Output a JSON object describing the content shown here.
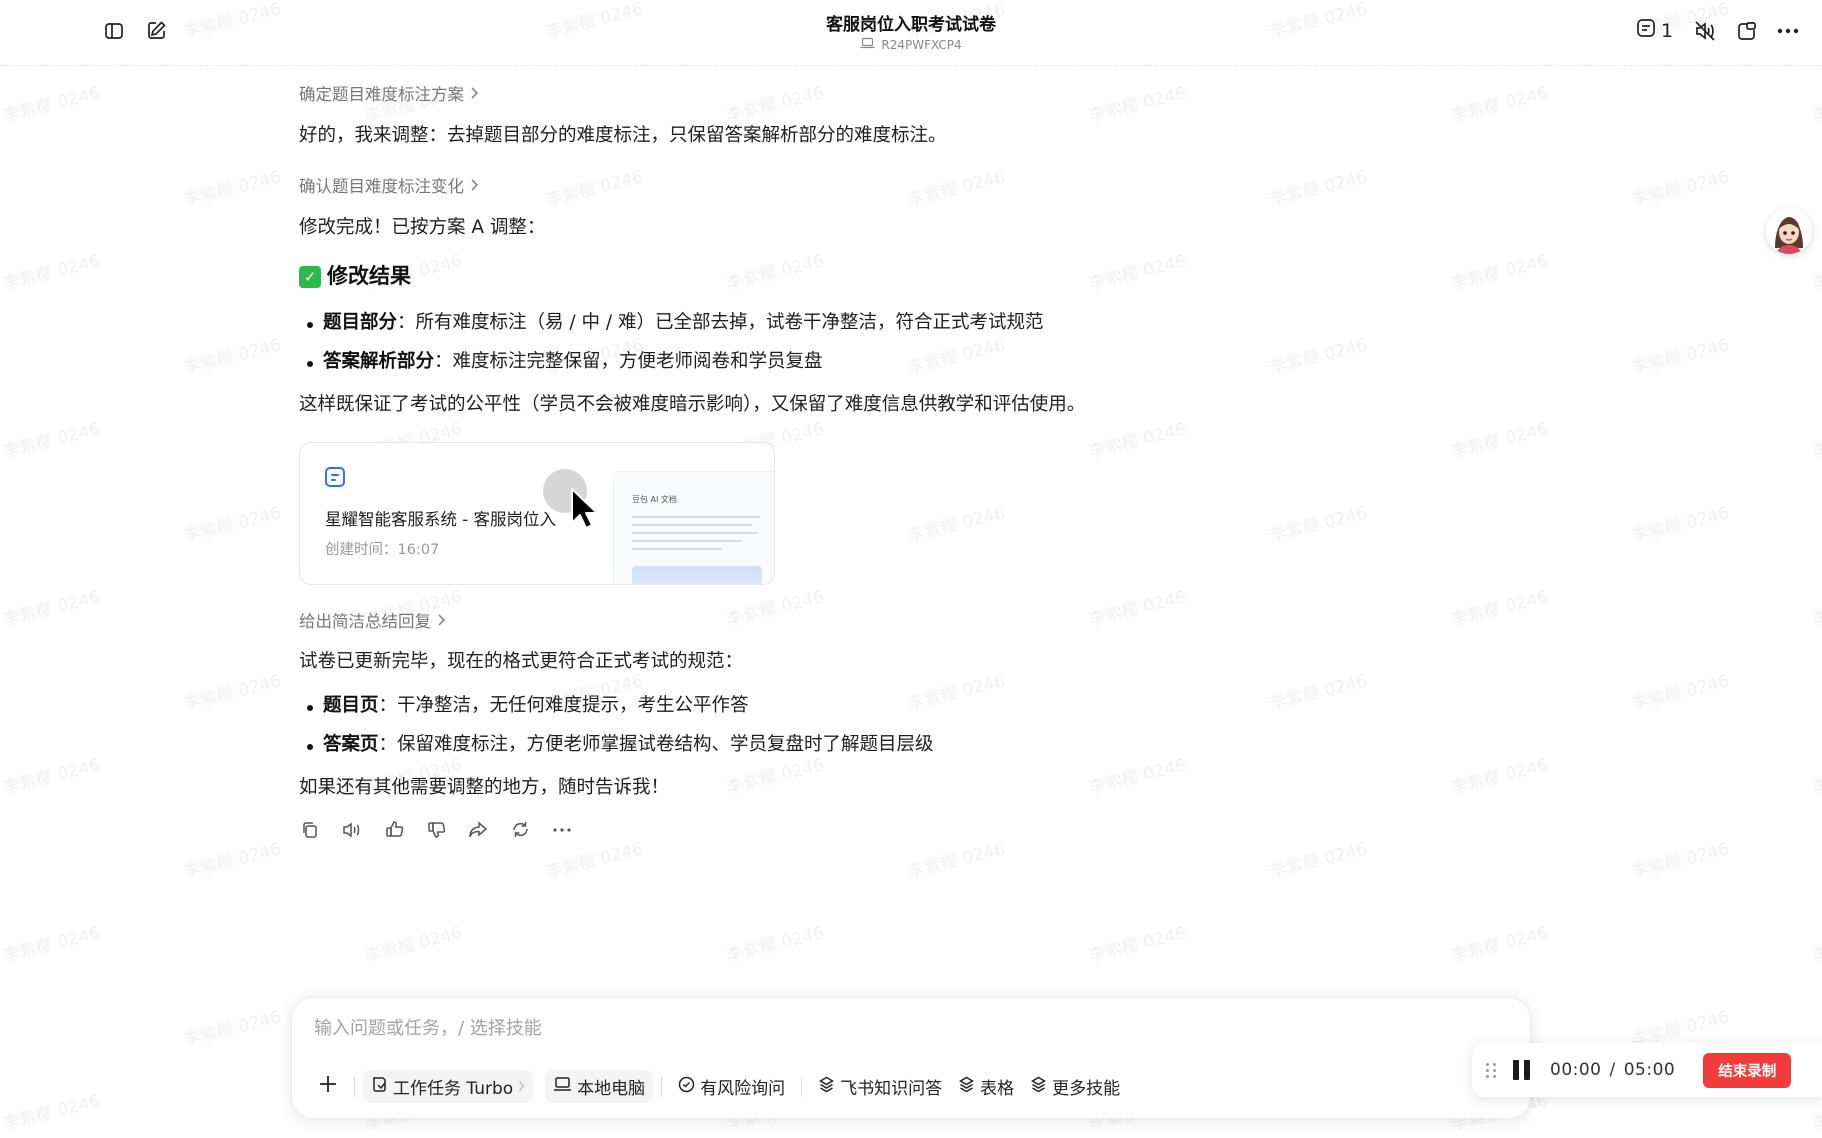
{
  "header": {
    "title": "客服岗位入职考试试卷",
    "device_id": "R24PWFXCP4",
    "message_count": "1"
  },
  "watermark_text": "李紫樱 0246",
  "chat": {
    "step1": "确定题目难度标注方案",
    "reply1": "好的，我来调整：去掉题目部分的难度标注，只保留答案解析部分的难度标注。",
    "step2": "确认题目难度标注变化",
    "reply2": "修改完成！已按方案 A 调整：",
    "result_heading": "修改结果",
    "bullets1": [
      {
        "label": "题目部分",
        "text": "：所有难度标注（易 / 中 / 难）已全部去掉，试卷干净整洁，符合正式考试规范"
      },
      {
        "label": "答案解析部分",
        "text": "：难度标注完整保留，方便老师阅卷和学员复盘"
      }
    ],
    "summary1": "这样既保证了考试的公平性（学员不会被难度暗示影响），又保留了难度信息供教学和评估使用。",
    "doc_card": {
      "title": "星耀智能客服系统 - 客服岗位入",
      "created_label": "创建时间：",
      "created_time": "16:07",
      "preview_title": "豆包 AI 文档"
    },
    "step3": "给出简洁总结回复",
    "reply3": "试卷已更新完毕，现在的格式更符合正式考试的规范：",
    "bullets2": [
      {
        "label": "题目页",
        "text": "：干净整洁，无任何难度提示，考生公平作答"
      },
      {
        "label": "答案页",
        "text": "：保留难度标注，方便老师掌握试卷结构、学员复盘时了解题目层级"
      }
    ],
    "closing": "如果还有其他需要调整的地方，随时告诉我！"
  },
  "composer": {
    "placeholder": "输入问题或任务，/ 选择技能",
    "tools": {
      "work_task": "工作任务 Turbo",
      "local_pc": "本地电脑",
      "risk_query": "有风险询问",
      "feishu_kb": "飞书知识问答",
      "table": "表格",
      "more_skills": "更多技能"
    }
  },
  "recorder": {
    "elapsed": "00:00",
    "total": "05:00",
    "separator": "/",
    "end_label": "结束录制"
  },
  "colors": {
    "accent_blue": "#3370ff",
    "success_green": "#2db84d",
    "record_red": "#f23c3c"
  },
  "icons": [
    "sidebar-toggle-icon",
    "new-chat-icon",
    "laptop-icon",
    "message-count-icon",
    "mute-icon",
    "pip-icon",
    "more-icon",
    "chevron-right-icon",
    "check-icon",
    "doc-icon",
    "copy-icon",
    "speaker-icon",
    "thumbs-up-icon",
    "thumbs-down-icon",
    "share-icon",
    "regenerate-icon",
    "plus-icon",
    "drag-handle-icon",
    "pause-icon"
  ]
}
